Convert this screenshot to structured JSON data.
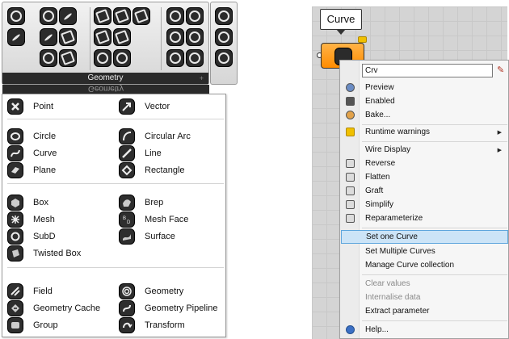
{
  "toolbar": {
    "title": "Geometry",
    "mirror_title": "Geometry"
  },
  "geometry_menu": {
    "groups": [
      {
        "left": [
          "Point"
        ],
        "right": [
          "Vector"
        ]
      },
      {
        "left": [
          "Circle",
          "Curve",
          "Plane"
        ],
        "right": [
          "Circular Arc",
          "Line",
          "Rectangle"
        ]
      },
      {
        "left": [
          "Box",
          "Mesh",
          "SubD",
          "Twisted Box"
        ],
        "right": [
          "Brep",
          "Mesh Face",
          "Surface"
        ]
      },
      {
        "left": [
          "Field",
          "Geometry Cache",
          "Group"
        ],
        "right": [
          "Geometry",
          "Geometry Pipeline",
          "Transform"
        ]
      }
    ]
  },
  "canvas": {
    "tooltip": "Curve"
  },
  "context_menu": {
    "nickname_value": "Crv",
    "items": {
      "preview": "Preview",
      "enabled": "Enabled",
      "bake": "Bake...",
      "runtime_warnings": "Runtime warnings",
      "wire_display": "Wire Display",
      "reverse": "Reverse",
      "flatten": "Flatten",
      "graft": "Graft",
      "simplify": "Simplify",
      "reparameterize": "Reparameterize",
      "set_one": "Set one Curve",
      "set_multiple": "Set Multiple Curves",
      "manage": "Manage Curve collection",
      "clear_values": "Clear values",
      "internalise": "Internalise data",
      "extract": "Extract parameter",
      "help": "Help..."
    }
  },
  "colors": {
    "accent_orange": "#ff8c00",
    "highlight": "#cce4f7",
    "icon_dark": "#2b2b2b"
  }
}
